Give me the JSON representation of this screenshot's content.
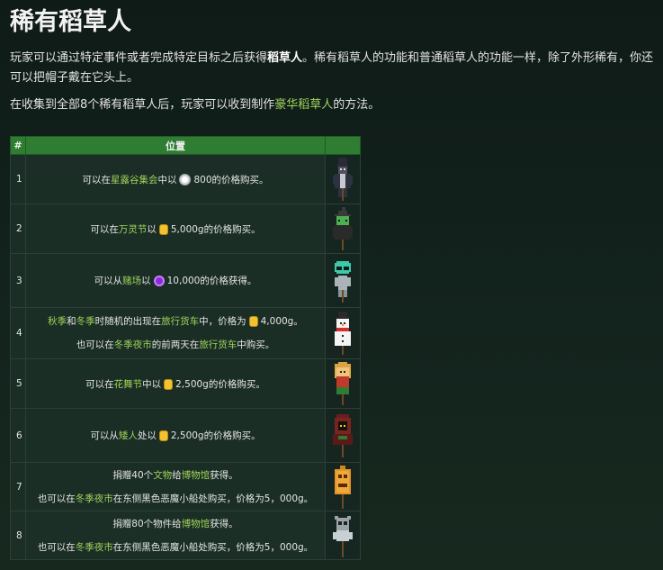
{
  "title": "稀有稻草人",
  "intro": {
    "p1a": "玩家可以通过特定事件或者完成特定目标之后获得",
    "p1b": "稻草人",
    "p1c": "。稀有稻草人的功能和普通稻草人的功能一样，除了外形稀有，你还可以把帽子戴在它头上。",
    "p2a": "在收集到全部8个稀有稻草人后，玩家可以收到制作",
    "p2b": "豪华稻草人",
    "p2c": "的方法。"
  },
  "table": {
    "headers": [
      "#",
      "位置",
      ""
    ],
    "rows": [
      {
        "num": "1",
        "lines": [
          [
            "可以在",
            "",
            "",
            ""
          ],
          []
        ],
        "l1a": "可以在",
        "l1b": "星露谷集会",
        "l1c": "中以",
        "l1d": "800的价格购买。"
      },
      {
        "num": "2",
        "l1a": "可以在",
        "l1b": "万灵节",
        "l1c": "以",
        "l1d": "5,000g的价格购买。"
      },
      {
        "num": "3",
        "l1a": "可以从",
        "l1b": "赌场",
        "l1c": "以",
        "l1d": "10,000的价格获得。"
      },
      {
        "num": "4",
        "l1a": "秋季",
        "l1b": "和",
        "l1c": "冬季",
        "l1d": "时随机的出现在",
        "l1e": "旅行货车",
        "l1f": "中，价格为",
        "l1g": "4,000g。",
        "l2a": "也可以在",
        "l2b": "冬季夜市",
        "l2c": "的前两天在",
        "l2d": "旅行货车",
        "l2e": "中购买。"
      },
      {
        "num": "5",
        "l1a": "可以在",
        "l1b": "花舞节",
        "l1c": "中以",
        "l1d": "2,500g的价格购买。"
      },
      {
        "num": "6",
        "l1a": "可以从",
        "l1b": "矮人",
        "l1c": "处以",
        "l1d": "2,500g的价格购买。"
      },
      {
        "num": "7",
        "l1a": "捐赠40个",
        "l1b": "文物",
        "l1c": "给",
        "l1d": "博物馆",
        "l1e": "获得。",
        "l2a": "也可以在",
        "l2b": "冬季夜市",
        "l2c": "在东侧黑色恶魔小船处购买，价格为5，000g。"
      },
      {
        "num": "8",
        "l1a": "捐赠80个物件给",
        "l1b": "博物馆",
        "l1c": "获得。",
        "l2a": "也可以在",
        "l2b": "冬季夜市",
        "l2c": "在东侧黑色恶魔小船处购买，价格为5，000g。"
      }
    ]
  },
  "icons": {
    "row1": "stardrop-star-icon",
    "row2": "gold-coin-icon",
    "row3": "qi-coin-icon",
    "row4": "gold-coin-icon",
    "row5": "gold-coin-icon",
    "row6": "gold-coin-icon"
  },
  "colors": {
    "header_bg": "#2e7d32",
    "link": "#9fd35b"
  }
}
